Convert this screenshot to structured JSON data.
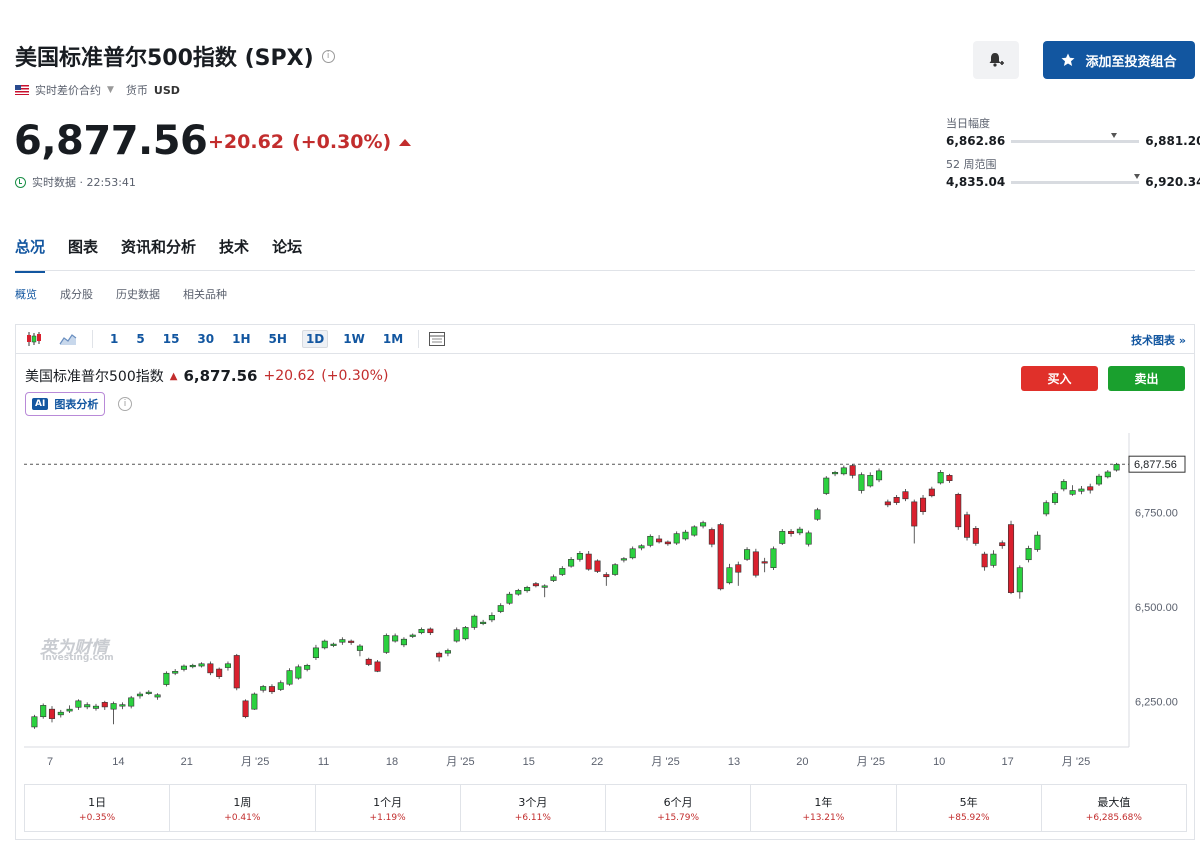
{
  "header": {
    "title": "美国标准普尔500指数 (SPX)",
    "contract_type": "实时差价合约",
    "currency_label": "货币",
    "currency_value": "USD",
    "price": "6,877.56",
    "change": "+20.62",
    "change_pct": "(+0.30%)",
    "realtime_label": "实时数据 · 22:53:41",
    "add_portfolio_label": "添加至投资组合"
  },
  "ranges": {
    "day": {
      "label": "当日幅度",
      "low": "6,862.86",
      "high": "6,881.20",
      "position": 0.8
    },
    "week52": {
      "label": "52 周范围",
      "low": "4,835.04",
      "high": "6,920.34",
      "position": 0.98
    }
  },
  "tabs": [
    {
      "label": "总况",
      "active": true
    },
    {
      "label": "图表",
      "active": false
    },
    {
      "label": "资讯和分析",
      "active": false
    },
    {
      "label": "技术",
      "active": false
    },
    {
      "label": "论坛",
      "active": false
    }
  ],
  "subtabs": [
    {
      "label": "概览",
      "active": true
    },
    {
      "label": "成分股",
      "active": false
    },
    {
      "label": "历史数据",
      "active": false
    },
    {
      "label": "相关品种",
      "active": false
    }
  ],
  "chart_toolbar": {
    "timeframes": [
      "1",
      "5",
      "15",
      "30",
      "1H",
      "5H",
      "1D",
      "1W",
      "1M"
    ],
    "active_timeframe": "1D",
    "tech_chart_label": "技术图表 »"
  },
  "chart_legend": {
    "name": "美国标准普尔500指数",
    "price": "6,877.56",
    "change": "+20.62",
    "change_pct": "(+0.30%)",
    "ai_badge": "AI",
    "ai_label": "图表分析",
    "buy_label": "买入",
    "sell_label": "卖出"
  },
  "watermark": {
    "main": "英为财情",
    "sub": "Investing.com"
  },
  "colors": {
    "up": "#2bd13f",
    "down": "#d9202e",
    "accent": "#1256a0",
    "change_red": "#c22d2d"
  },
  "chart_data": {
    "type": "candlestick",
    "ylim": [
      6130,
      6960
    ],
    "y_ticks": [
      6250,
      6500,
      6750
    ],
    "y_tick_labels": [
      "6,250.00",
      "6,500.00",
      "6,750.00"
    ],
    "current_price": 6877.56,
    "current_price_label": "6,877.56",
    "x_tick_labels": [
      "7",
      "14",
      "21",
      "月 '25",
      "11",
      "18",
      "月 '25",
      "15",
      "22",
      "月 '25",
      "13",
      "20",
      "月 '25",
      "10",
      "17",
      "月 '25"
    ],
    "candles": [
      [
        6183,
        6210,
        6178,
        6215
      ],
      [
        6210,
        6240,
        6205,
        6245
      ],
      [
        6230,
        6205,
        6195,
        6238
      ],
      [
        6215,
        6222,
        6208,
        6228
      ],
      [
        6225,
        6230,
        6220,
        6240
      ],
      [
        6235,
        6252,
        6228,
        6256
      ],
      [
        6236,
        6242,
        6230,
        6248
      ],
      [
        6232,
        6238,
        6226,
        6244
      ],
      [
        6248,
        6236,
        6228,
        6252
      ],
      [
        6230,
        6245,
        6190,
        6250
      ],
      [
        6238,
        6242,
        6230,
        6248
      ],
      [
        6238,
        6260,
        6232,
        6265
      ],
      [
        6265,
        6270,
        6258,
        6276
      ],
      [
        6272,
        6275,
        6268,
        6280
      ],
      [
        6262,
        6268,
        6255,
        6272
      ],
      [
        6295,
        6325,
        6290,
        6330
      ],
      [
        6325,
        6330,
        6320,
        6336
      ],
      [
        6335,
        6344,
        6330,
        6348
      ],
      [
        6342,
        6346,
        6338,
        6350
      ],
      [
        6344,
        6350,
        6340,
        6354
      ],
      [
        6350,
        6326,
        6320,
        6356
      ],
      [
        6336,
        6316,
        6310,
        6340
      ],
      [
        6340,
        6350,
        6332,
        6356
      ],
      [
        6372,
        6286,
        6280,
        6376
      ],
      [
        6252,
        6210,
        6206,
        6256
      ],
      [
        6230,
        6270,
        6228,
        6274
      ],
      [
        6280,
        6290,
        6274,
        6294
      ],
      [
        6290,
        6276,
        6270,
        6296
      ],
      [
        6282,
        6300,
        6278,
        6306
      ],
      [
        6296,
        6332,
        6292,
        6338
      ],
      [
        6312,
        6342,
        6308,
        6348
      ],
      [
        6335,
        6346,
        6330,
        6350
      ],
      [
        6366,
        6392,
        6360,
        6400
      ],
      [
        6392,
        6410,
        6388,
        6414
      ],
      [
        6398,
        6402,
        6394,
        6406
      ],
      [
        6407,
        6414,
        6400,
        6420
      ],
      [
        6410,
        6408,
        6400,
        6414
      ],
      [
        6385,
        6397,
        6370,
        6402
      ],
      [
        6362,
        6348,
        6344,
        6366
      ],
      [
        6355,
        6330,
        6328,
        6360
      ],
      [
        6380,
        6425,
        6376,
        6430
      ],
      [
        6410,
        6424,
        6406,
        6430
      ],
      [
        6400,
        6415,
        6394,
        6420
      ],
      [
        6422,
        6426,
        6418,
        6430
      ],
      [
        6432,
        6441,
        6428,
        6446
      ],
      [
        6442,
        6432,
        6426,
        6446
      ],
      [
        6378,
        6368,
        6356,
        6382
      ],
      [
        6378,
        6385,
        6370,
        6390
      ],
      [
        6410,
        6440,
        6406,
        6446
      ],
      [
        6416,
        6446,
        6412,
        6450
      ],
      [
        6446,
        6476,
        6440,
        6480
      ],
      [
        6460,
        6460,
        6452,
        6466
      ],
      [
        6466,
        6478,
        6460,
        6486
      ],
      [
        6488,
        6504,
        6484,
        6510
      ],
      [
        6510,
        6534,
        6506,
        6540
      ],
      [
        6534,
        6544,
        6530,
        6548
      ],
      [
        6543,
        6552,
        6538,
        6556
      ],
      [
        6562,
        6556,
        6552,
        6566
      ],
      [
        6552,
        6556,
        6526,
        6560
      ],
      [
        6570,
        6580,
        6566,
        6586
      ],
      [
        6586,
        6602,
        6582,
        6608
      ],
      [
        6608,
        6626,
        6604,
        6632
      ],
      [
        6626,
        6642,
        6620,
        6648
      ],
      [
        6640,
        6600,
        6596,
        6648
      ],
      [
        6622,
        6594,
        6590,
        6626
      ],
      [
        6586,
        6580,
        6556,
        6592
      ],
      [
        6586,
        6612,
        6582,
        6616
      ],
      [
        6624,
        6628,
        6618,
        6632
      ],
      [
        6630,
        6654,
        6626,
        6660
      ],
      [
        6656,
        6662,
        6650,
        6666
      ],
      [
        6663,
        6687,
        6658,
        6692
      ],
      [
        6680,
        6672,
        6668,
        6690
      ],
      [
        6672,
        6667,
        6662,
        6676
      ],
      [
        6669,
        6694,
        6664,
        6700
      ],
      [
        6680,
        6698,
        6676,
        6704
      ],
      [
        6690,
        6712,
        6686,
        6716
      ],
      [
        6714,
        6723,
        6708,
        6728
      ],
      [
        6705,
        6666,
        6658,
        6710
      ],
      [
        6718,
        6548,
        6544,
        6722
      ],
      [
        6564,
        6604,
        6560,
        6614
      ],
      [
        6612,
        6592,
        6556,
        6620
      ],
      [
        6626,
        6652,
        6622,
        6658
      ],
      [
        6646,
        6584,
        6578,
        6654
      ],
      [
        6620,
        6618,
        6592,
        6630
      ],
      [
        6604,
        6654,
        6598,
        6660
      ],
      [
        6668,
        6700,
        6664,
        6706
      ],
      [
        6700,
        6694,
        6686,
        6706
      ],
      [
        6696,
        6706,
        6690,
        6712
      ],
      [
        6666,
        6696,
        6660,
        6702
      ],
      [
        6732,
        6757,
        6728,
        6762
      ],
      [
        6800,
        6841,
        6796,
        6846
      ],
      [
        6852,
        6856,
        6846,
        6860
      ],
      [
        6852,
        6868,
        6848,
        6874
      ],
      [
        6874,
        6848,
        6840,
        6878
      ],
      [
        6808,
        6850,
        6800,
        6856
      ],
      [
        6820,
        6848,
        6816,
        6856
      ],
      [
        6836,
        6860,
        6830,
        6866
      ],
      [
        6778,
        6770,
        6764,
        6784
      ],
      [
        6790,
        6776,
        6770,
        6796
      ],
      [
        6805,
        6786,
        6780,
        6812
      ],
      [
        6778,
        6714,
        6668,
        6784
      ],
      [
        6788,
        6752,
        6744,
        6796
      ],
      [
        6812,
        6794,
        6790,
        6818
      ],
      [
        6828,
        6856,
        6824,
        6862
      ],
      [
        6848,
        6834,
        6828,
        6852
      ],
      [
        6798,
        6712,
        6704,
        6802
      ],
      [
        6744,
        6684,
        6676,
        6752
      ],
      [
        6708,
        6668,
        6662,
        6714
      ],
      [
        6640,
        6606,
        6596,
        6646
      ],
      [
        6610,
        6640,
        6604,
        6650
      ],
      [
        6670,
        6662,
        6654,
        6676
      ],
      [
        6718,
        6538,
        6534,
        6728
      ],
      [
        6540,
        6604,
        6522,
        6610
      ],
      [
        6625,
        6655,
        6618,
        6662
      ],
      [
        6652,
        6690,
        6646,
        6700
      ],
      [
        6746,
        6776,
        6740,
        6782
      ],
      [
        6776,
        6800,
        6770,
        6806
      ],
      [
        6812,
        6832,
        6806,
        6838
      ],
      [
        6798,
        6808,
        6794,
        6822
      ],
      [
        6806,
        6812,
        6798,
        6820
      ],
      [
        6818,
        6809,
        6800,
        6826
      ],
      [
        6825,
        6846,
        6820,
        6852
      ],
      [
        6844,
        6857,
        6840,
        6862
      ],
      [
        6862,
        6877,
        6858,
        6881
      ]
    ]
  },
  "performance": [
    {
      "label": "1日",
      "value": "+0.35%"
    },
    {
      "label": "1周",
      "value": "+0.41%"
    },
    {
      "label": "1个月",
      "value": "+1.19%"
    },
    {
      "label": "3个月",
      "value": "+6.11%"
    },
    {
      "label": "6个月",
      "value": "+15.79%"
    },
    {
      "label": "1年",
      "value": "+13.21%"
    },
    {
      "label": "5年",
      "value": "+85.92%"
    },
    {
      "label": "最大值",
      "value": "+6,285.68%"
    }
  ]
}
